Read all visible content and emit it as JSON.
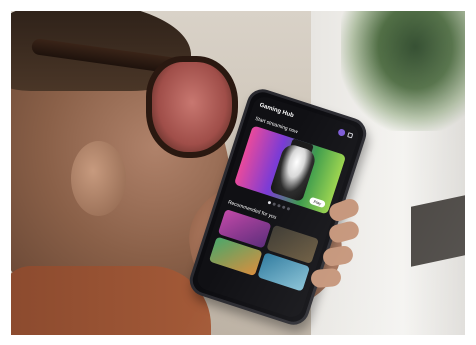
{
  "phone": {
    "app_title": "Gaming Hub",
    "hero_section_title": "Start streaming now",
    "hero_play_label": "Play",
    "recommended_title": "Recommended for you"
  }
}
